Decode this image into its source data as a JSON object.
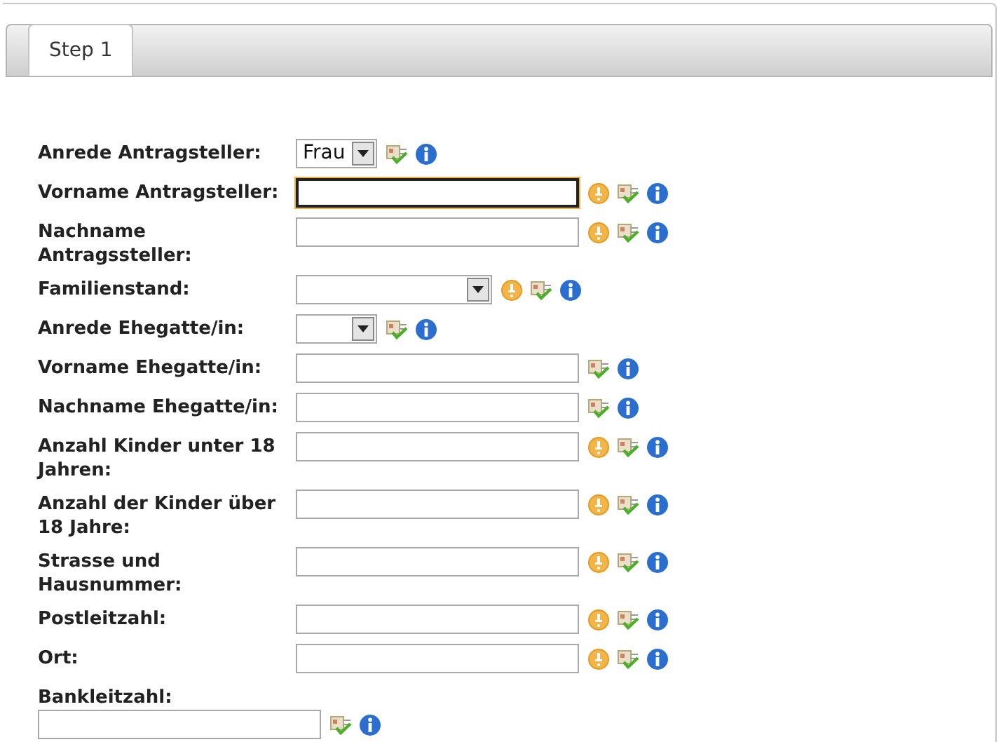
{
  "tabs": [
    {
      "label": "Step 1",
      "selected": true
    }
  ],
  "fields": [
    {
      "label": "Anrede Antragsteller:",
      "kind": "select",
      "value": "Frau",
      "required": false,
      "focused": false,
      "stacked": false
    },
    {
      "label": "Vorname Antragsteller:",
      "kind": "text",
      "required": true,
      "focused": true,
      "stacked": false
    },
    {
      "label": "Nachname Antragssteller:",
      "kind": "text",
      "required": true,
      "focused": false,
      "stacked": false
    },
    {
      "label": "Familienstand:",
      "kind": "list",
      "required": true,
      "focused": false,
      "stacked": false
    },
    {
      "label": "Anrede Ehegatte/in:",
      "kind": "select",
      "required": false,
      "focused": false,
      "stacked": false
    },
    {
      "label": "Vorname Ehegatte/in:",
      "kind": "text",
      "required": false,
      "focused": false,
      "stacked": false
    },
    {
      "label": "Nachname Ehegatte/in:",
      "kind": "text",
      "required": false,
      "focused": false,
      "stacked": false
    },
    {
      "label": "Anzahl Kinder unter 18 Jahren:",
      "kind": "text",
      "required": true,
      "focused": false,
      "stacked": false
    },
    {
      "label": "Anzahl der Kinder über 18 Jahre:",
      "kind": "text",
      "required": true,
      "focused": false,
      "stacked": false
    },
    {
      "label": "Strasse und Hausnummer:",
      "kind": "text",
      "required": true,
      "focused": false,
      "stacked": false
    },
    {
      "label": "Postleitzahl:",
      "kind": "text",
      "required": true,
      "focused": false,
      "stacked": false
    },
    {
      "label": "Ort:",
      "kind": "text",
      "required": true,
      "focused": false,
      "stacked": false
    },
    {
      "label": "Bankleitzahl:",
      "kind": "text",
      "required": false,
      "focused": false,
      "stacked": true
    }
  ]
}
